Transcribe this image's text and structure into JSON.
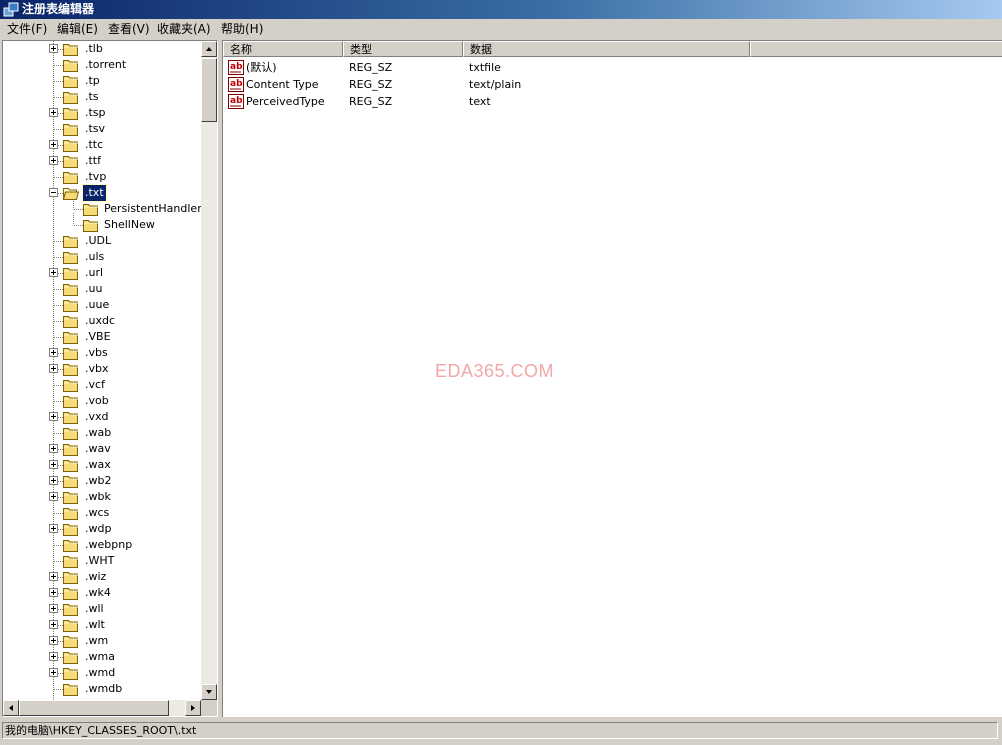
{
  "window": {
    "title": "注册表编辑器",
    "icon": "regedit-icon"
  },
  "menu": [
    {
      "label": "文件(F)"
    },
    {
      "label": "编辑(E)"
    },
    {
      "label": "查看(V)"
    },
    {
      "label": "收藏夹(A)"
    },
    {
      "label": "帮助(H)"
    }
  ],
  "tree": {
    "nodes": [
      {
        "label": ".tlb",
        "depth": 0,
        "expander": "plus"
      },
      {
        "label": ".torrent",
        "depth": 0,
        "expander": "none"
      },
      {
        "label": ".tp",
        "depth": 0,
        "expander": "none"
      },
      {
        "label": ".ts",
        "depth": 0,
        "expander": "none"
      },
      {
        "label": ".tsp",
        "depth": 0,
        "expander": "plus"
      },
      {
        "label": ".tsv",
        "depth": 0,
        "expander": "none"
      },
      {
        "label": ".ttc",
        "depth": 0,
        "expander": "plus"
      },
      {
        "label": ".ttf",
        "depth": 0,
        "expander": "plus"
      },
      {
        "label": ".tvp",
        "depth": 0,
        "expander": "none"
      },
      {
        "label": ".txt",
        "depth": 0,
        "expander": "minus",
        "selected": true,
        "open": true
      },
      {
        "label": "PersistentHandler",
        "depth": 1,
        "expander": "none"
      },
      {
        "label": "ShellNew",
        "depth": 1,
        "expander": "none"
      },
      {
        "label": ".UDL",
        "depth": 0,
        "expander": "none"
      },
      {
        "label": ".uls",
        "depth": 0,
        "expander": "none"
      },
      {
        "label": ".url",
        "depth": 0,
        "expander": "plus"
      },
      {
        "label": ".uu",
        "depth": 0,
        "expander": "none"
      },
      {
        "label": ".uue",
        "depth": 0,
        "expander": "none"
      },
      {
        "label": ".uxdc",
        "depth": 0,
        "expander": "none"
      },
      {
        "label": ".VBE",
        "depth": 0,
        "expander": "none"
      },
      {
        "label": ".vbs",
        "depth": 0,
        "expander": "plus"
      },
      {
        "label": ".vbx",
        "depth": 0,
        "expander": "plus"
      },
      {
        "label": ".vcf",
        "depth": 0,
        "expander": "none"
      },
      {
        "label": ".vob",
        "depth": 0,
        "expander": "none"
      },
      {
        "label": ".vxd",
        "depth": 0,
        "expander": "plus"
      },
      {
        "label": ".wab",
        "depth": 0,
        "expander": "none"
      },
      {
        "label": ".wav",
        "depth": 0,
        "expander": "plus"
      },
      {
        "label": ".wax",
        "depth": 0,
        "expander": "plus"
      },
      {
        "label": ".wb2",
        "depth": 0,
        "expander": "plus"
      },
      {
        "label": ".wbk",
        "depth": 0,
        "expander": "plus"
      },
      {
        "label": ".wcs",
        "depth": 0,
        "expander": "none"
      },
      {
        "label": ".wdp",
        "depth": 0,
        "expander": "plus"
      },
      {
        "label": ".webpnp",
        "depth": 0,
        "expander": "none"
      },
      {
        "label": ".WHT",
        "depth": 0,
        "expander": "none"
      },
      {
        "label": ".wiz",
        "depth": 0,
        "expander": "plus"
      },
      {
        "label": ".wk4",
        "depth": 0,
        "expander": "plus"
      },
      {
        "label": ".wll",
        "depth": 0,
        "expander": "plus"
      },
      {
        "label": ".wlt",
        "depth": 0,
        "expander": "plus"
      },
      {
        "label": ".wm",
        "depth": 0,
        "expander": "plus"
      },
      {
        "label": ".wma",
        "depth": 0,
        "expander": "plus"
      },
      {
        "label": ".wmd",
        "depth": 0,
        "expander": "plus"
      },
      {
        "label": ".wmdb",
        "depth": 0,
        "expander": "none"
      }
    ]
  },
  "list": {
    "columns": [
      {
        "label": "名称"
      },
      {
        "label": "类型"
      },
      {
        "label": "数据"
      }
    ],
    "rows": [
      {
        "name": "(默认)",
        "type": "REG_SZ",
        "data": "txtfile",
        "icon": "string-value-icon"
      },
      {
        "name": "Content Type",
        "type": "REG_SZ",
        "data": "text/plain",
        "icon": "string-value-icon"
      },
      {
        "name": "PerceivedType",
        "type": "REG_SZ",
        "data": "text",
        "icon": "string-value-icon"
      }
    ]
  },
  "watermark": "EDA365.COM",
  "status": {
    "path": "我的电脑\\HKEY_CLASSES_ROOT\\.txt"
  },
  "colors": {
    "title_start": "#0a246a",
    "title_end": "#a6caf0",
    "selection": "#0a246a",
    "face": "#d4d0c8"
  }
}
